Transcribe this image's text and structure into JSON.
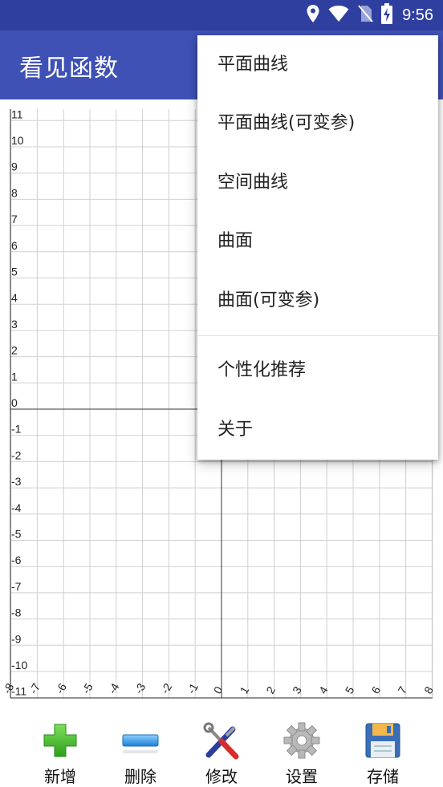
{
  "status_bar": {
    "time": "9:56",
    "icons": [
      "location-icon",
      "wifi-icon",
      "no-sim-icon",
      "battery-charging-icon"
    ]
  },
  "app_bar": {
    "title": "看见函数"
  },
  "graph": {
    "y_ticks": [
      "11",
      "10",
      "9",
      "8",
      "7",
      "6",
      "5",
      "4",
      "3",
      "2",
      "1",
      "0",
      "-1",
      "-2",
      "-3",
      "-4",
      "-5",
      "-6",
      "-7",
      "-8",
      "-9",
      "-10",
      "-11"
    ],
    "x_ticks": [
      "-8",
      "-7",
      "-6",
      "-5",
      "-4",
      "-3",
      "-2",
      "-1",
      "0",
      "1",
      "2",
      "3",
      "4",
      "5",
      "6",
      "7",
      "8"
    ],
    "colors": {
      "grid": "#d0d0d0",
      "axis": "#333333",
      "text": "#222222"
    }
  },
  "toolbar": {
    "buttons": [
      {
        "label": "新增",
        "icon": "add-icon"
      },
      {
        "label": "删除",
        "icon": "remove-icon"
      },
      {
        "label": "修改",
        "icon": "tools-icon"
      },
      {
        "label": "设置",
        "icon": "gear-icon"
      },
      {
        "label": "存储",
        "icon": "save-icon"
      }
    ]
  },
  "menu": {
    "items": [
      "平面曲线",
      "平面曲线(可变参)",
      "空间曲线",
      "曲面",
      "曲面(可变参)",
      "个性化推荐",
      "关于"
    ]
  },
  "colors": {
    "status_bar": "#2f3f9f",
    "app_bar": "#3f51b5"
  }
}
